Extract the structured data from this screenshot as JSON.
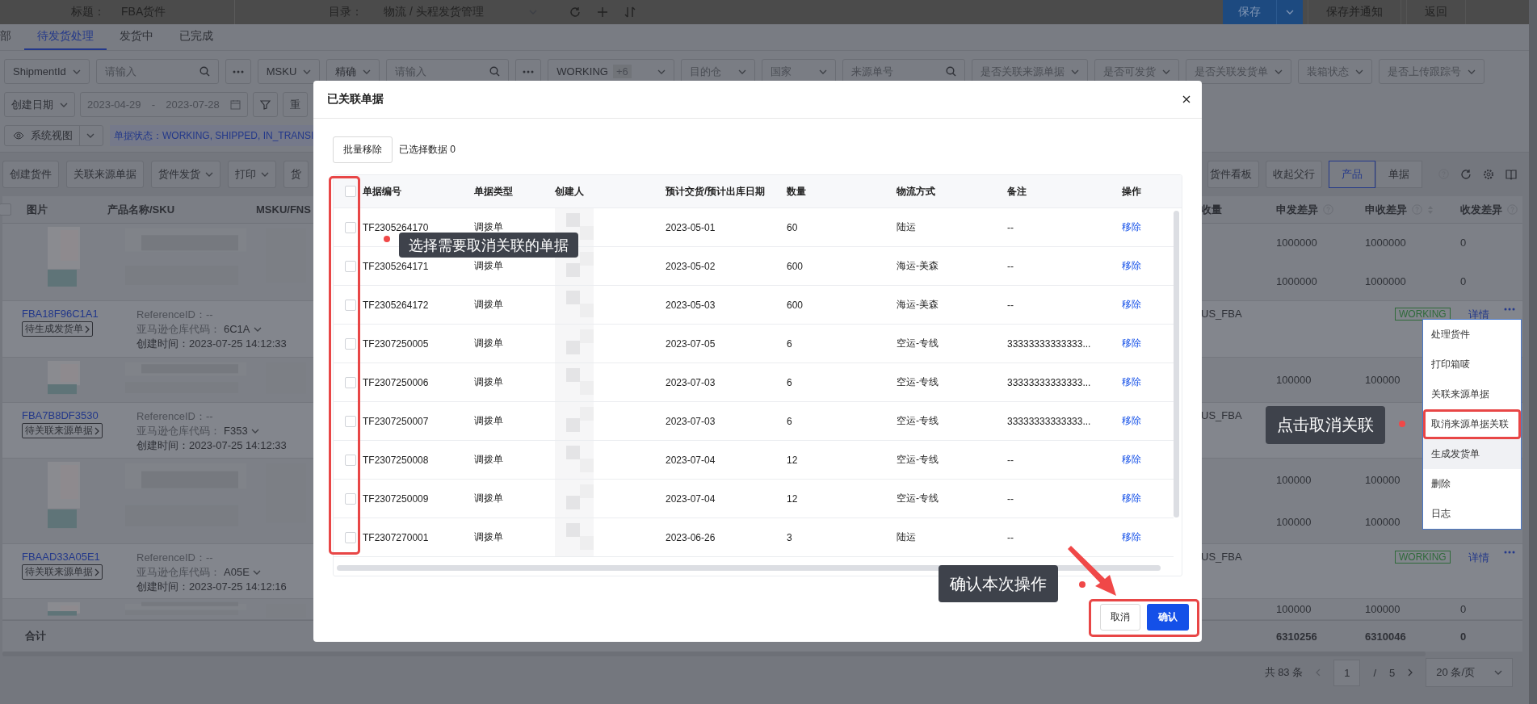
{
  "top_bar": {
    "title_label": "标题：",
    "title": "FBA货件",
    "catalog_label": "目录：",
    "catalog": "物流 / 头程发货管理",
    "save": "保存",
    "save_notify": "保存并通知",
    "back": "返回"
  },
  "tabs": [
    {
      "label": "部",
      "selected": false
    },
    {
      "label": "待发货处理",
      "selected": true
    },
    {
      "label": "发货中",
      "selected": false
    },
    {
      "label": "已完成",
      "selected": false
    }
  ],
  "filters": [
    {
      "kind": "select",
      "label": "ShipmentId"
    },
    {
      "kind": "search",
      "placeholder": "请输入",
      "more": true
    },
    {
      "kind": "select",
      "label": "MSKU"
    },
    {
      "kind": "select",
      "label": "精确"
    },
    {
      "kind": "search",
      "placeholder": "请输入",
      "more": true
    },
    {
      "kind": "multi",
      "label": "WORKING",
      "count": "+6"
    },
    {
      "kind": "select",
      "placeholder": "目的仓"
    },
    {
      "kind": "select",
      "placeholder": "国家"
    },
    {
      "kind": "search",
      "placeholder": "来源单号",
      "more": false
    },
    {
      "kind": "select",
      "placeholder": "是否关联来源单据"
    },
    {
      "kind": "select",
      "placeholder": "是否可发货"
    },
    {
      "kind": "select",
      "placeholder": "是否关联发货单"
    },
    {
      "kind": "select",
      "placeholder": "装箱状态"
    },
    {
      "kind": "select",
      "placeholder": "是否上传跟踪号"
    }
  ],
  "date_filter": {
    "label": "创建日期",
    "start": "2023-04-29",
    "separator": "-",
    "end": "2023-07-28",
    "reset": "重"
  },
  "view_bar": {
    "view": "系统视图",
    "summary": "单据状态：WORKING, SHIPPED, IN_TRANSI"
  },
  "toolbar": {
    "left": [
      {
        "label": "创建货件",
        "dropdown": false
      },
      {
        "label": "关联来源单据",
        "dropdown": false
      },
      {
        "label": "货件发货",
        "dropdown": true
      },
      {
        "label": "打印",
        "dropdown": true
      },
      {
        "label": "货",
        "dropdown": false
      }
    ],
    "board": "货件看板",
    "collapse": "收起父行",
    "view_toggle": [
      {
        "label": "产品",
        "selected": true
      },
      {
        "label": "单据",
        "selected": false
      }
    ]
  },
  "table": {
    "header_checked": false,
    "left_columns": [
      "图片",
      "产品名称/SKU",
      "MSKU/FNS"
    ],
    "right_columns": [
      {
        "label": "收量",
        "help": false,
        "sort": false
      },
      {
        "label": "申发差异",
        "help": true,
        "sort": false
      },
      {
        "label": "申收差异",
        "help": true,
        "sort": true
      },
      {
        "label": "收发差异",
        "help": true,
        "sort": false
      }
    ],
    "rows": [
      {
        "kind": "product",
        "lines": [
          [
            "1000000",
            "1000000",
            "0"
          ],
          [
            "1000000",
            "1000000",
            "0"
          ]
        ]
      },
      {
        "kind": "shipment",
        "id": "FBA18F96C1A1",
        "tag": "待生成发货单",
        "reference": "ReferenceID：--",
        "warehouse_label": "亚马逊仓库代码：",
        "warehouse": "6C1A",
        "created": "创建时间：2023-07-25 14:12:33",
        "channel": "US_FBA",
        "status": "WORKING",
        "detail": "详情"
      },
      {
        "kind": "product",
        "lines": [
          [
            "100000",
            "100000"
          ]
        ]
      },
      {
        "kind": "shipment",
        "id": "FBA7B8DF3530",
        "tag": "待关联来源单据",
        "reference": "ReferenceID：--",
        "warehouse_label": "亚马逊仓库代码：",
        "warehouse": "F353",
        "created": "创建时间：2023-07-25 14:12:33",
        "channel": "US_FBA"
      },
      {
        "kind": "product",
        "lines": [
          [
            "100000",
            "100000"
          ],
          [
            "100000",
            "100000"
          ]
        ]
      },
      {
        "kind": "shipment",
        "id": "FBAAD33A05E1",
        "tag": "待关联来源单据",
        "reference": "ReferenceID：--",
        "warehouse_label": "亚马逊仓库代码：",
        "warehouse": "A05E",
        "created": "创建时间：2023-07-25 14:12:16",
        "channel": "US_FBA",
        "status": "WORKING",
        "detail": "详情"
      },
      {
        "kind": "product",
        "lines": [
          [
            "100000",
            "100000",
            "0"
          ]
        ]
      }
    ],
    "total": {
      "label": "合计",
      "values": [
        "6310256",
        "6310046",
        "0"
      ]
    }
  },
  "pagination": {
    "total": "共 83 条",
    "page": "1",
    "separator": "/",
    "pages": "5",
    "page_size": "20 条/页"
  },
  "modal": {
    "title": "已关联单据",
    "batch_remove": "批量移除",
    "selected_count": "已选择数据 0",
    "header_checked": false,
    "columns": [
      "单据编号",
      "单据类型",
      "创建人",
      "预计交货/预计出库日期",
      "数量",
      "物流方式",
      "备注",
      "操作"
    ],
    "rows": [
      {
        "checked": false,
        "number": "TF2305264170",
        "type": "调拨单",
        "date": "2023-05-01",
        "qty": "60",
        "shipping": "陆运",
        "note": "--",
        "action": "移除"
      },
      {
        "checked": false,
        "number": "TF2305264171",
        "type": "调拨单",
        "date": "2023-05-02",
        "qty": "600",
        "shipping": "海运-美森",
        "note": "--",
        "action": "移除"
      },
      {
        "checked": false,
        "number": "TF2305264172",
        "type": "调拨单",
        "date": "2023-05-03",
        "qty": "600",
        "shipping": "海运-美森",
        "note": "--",
        "action": "移除"
      },
      {
        "checked": false,
        "number": "TF2307250005",
        "type": "调拨单",
        "date": "2023-07-05",
        "qty": "6",
        "shipping": "空运-专线",
        "note": "33333333333333...",
        "action": "移除"
      },
      {
        "checked": false,
        "number": "TF2307250006",
        "type": "调拨单",
        "date": "2023-07-03",
        "qty": "6",
        "shipping": "空运-专线",
        "note": "33333333333333...",
        "action": "移除"
      },
      {
        "checked": false,
        "number": "TF2307250007",
        "type": "调拨单",
        "date": "2023-07-03",
        "qty": "6",
        "shipping": "空运-专线",
        "note": "33333333333333...",
        "action": "移除"
      },
      {
        "checked": false,
        "number": "TF2307250008",
        "type": "调拨单",
        "date": "2023-07-04",
        "qty": "12",
        "shipping": "空运-专线",
        "note": "--",
        "action": "移除"
      },
      {
        "checked": false,
        "number": "TF2307250009",
        "type": "调拨单",
        "date": "2023-07-04",
        "qty": "12",
        "shipping": "空运-专线",
        "note": "--",
        "action": "移除"
      },
      {
        "checked": false,
        "number": "TF2307270001",
        "type": "调拨单",
        "date": "2023-06-26",
        "qty": "3",
        "shipping": "陆运",
        "note": "--",
        "action": "移除"
      }
    ],
    "cancel": "取消",
    "confirm": "确认"
  },
  "row_menu": {
    "items": [
      {
        "label": "处理货件",
        "outlined": false,
        "hovered": false
      },
      {
        "label": "打印箱唛",
        "outlined": false,
        "hovered": false
      },
      {
        "label": "关联来源单据",
        "outlined": false,
        "hovered": false
      },
      {
        "label": "取消来源单据关联",
        "outlined": true,
        "hovered": false
      },
      {
        "label": "生成发货单",
        "outlined": false,
        "hovered": true
      },
      {
        "label": "删除",
        "outlined": false,
        "hovered": false
      },
      {
        "label": "日志",
        "outlined": false,
        "hovered": false
      }
    ]
  },
  "callouts": [
    {
      "text": "选择需要取消关联的单据"
    },
    {
      "text": "确认本次操作"
    },
    {
      "text": "点击取消关联"
    }
  ]
}
